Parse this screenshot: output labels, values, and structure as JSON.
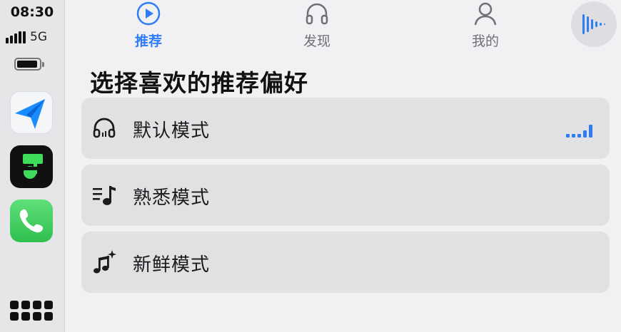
{
  "status": {
    "time": "08:30",
    "network": "5G"
  },
  "dock_apps": [
    {
      "name": "maps-app",
      "icon": "paper-plane-navigation-icon"
    },
    {
      "name": "music-app",
      "icon": "music-note-icon"
    },
    {
      "name": "phone-app",
      "icon": "phone-handset-icon"
    }
  ],
  "tabs": [
    {
      "label": "推荐",
      "icon": "play-circle-icon",
      "active": true
    },
    {
      "label": "发现",
      "icon": "headphones-icon",
      "active": false
    },
    {
      "label": "我的",
      "icon": "person-icon",
      "active": false
    }
  ],
  "page_title": "选择喜欢的推荐偏好",
  "modes": [
    {
      "label": "默认模式",
      "icon": "headphones-icon",
      "selected": true
    },
    {
      "label": "熟悉模式",
      "icon": "list-music-icon",
      "selected": false
    },
    {
      "label": "新鲜模式",
      "icon": "music-note-sparkle-icon",
      "selected": false
    }
  ],
  "colors": {
    "accent": "#2f7df6",
    "row_background": "#e1e1e4",
    "page_background": "#f1f1f3"
  }
}
